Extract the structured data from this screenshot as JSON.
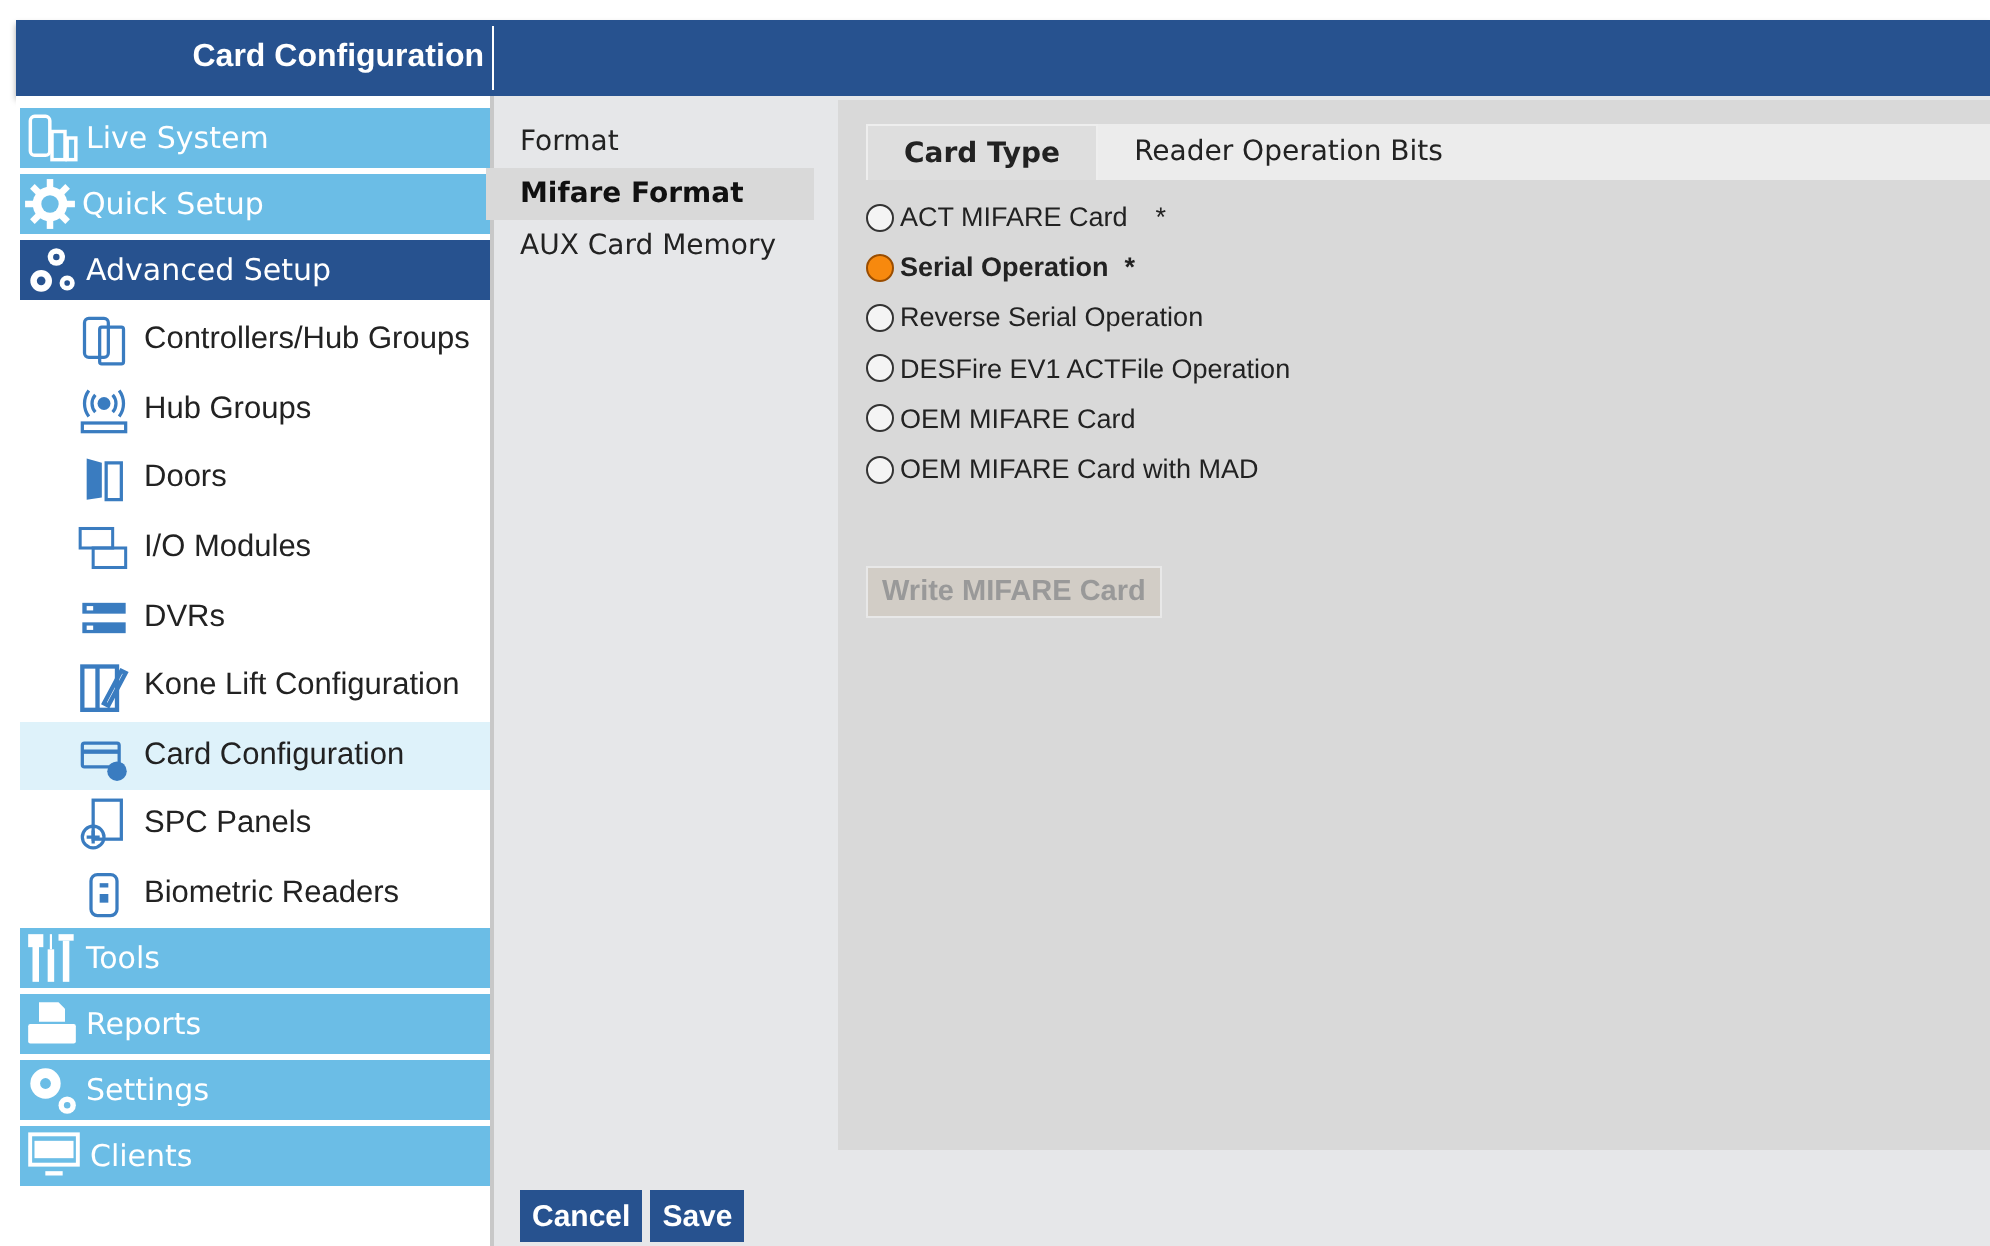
{
  "header": {
    "title": "Card Configuration"
  },
  "sidebar": {
    "items": [
      {
        "label": "Live System",
        "selected": false
      },
      {
        "label": "Quick Setup",
        "selected": false
      },
      {
        "label": "Advanced Setup",
        "selected": true,
        "children": [
          {
            "label": "Controllers/Hub Groups",
            "selected": false
          },
          {
            "label": "Hub Groups",
            "selected": false
          },
          {
            "label": "Doors",
            "selected": false
          },
          {
            "label": "I/O Modules",
            "selected": false
          },
          {
            "label": "DVRs",
            "selected": false
          },
          {
            "label": "Kone Lift Configuration",
            "selected": false
          },
          {
            "label": "Card Configuration",
            "selected": true
          },
          {
            "label": "SPC Panels",
            "selected": false
          },
          {
            "label": "Biometric Readers",
            "selected": false
          }
        ]
      },
      {
        "label": "Tools",
        "selected": false
      },
      {
        "label": "Reports",
        "selected": false
      },
      {
        "label": "Settings",
        "selected": false
      },
      {
        "label": "Clients",
        "selected": false
      }
    ]
  },
  "subnav": [
    {
      "label": "Format",
      "selected": false
    },
    {
      "label": "Mifare Format",
      "selected": true
    },
    {
      "label": "AUX Card Memory",
      "selected": false
    }
  ],
  "tabs": [
    {
      "label": "Card Type",
      "selected": true
    },
    {
      "label": "Reader Operation Bits",
      "selected": false
    }
  ],
  "card_types": [
    {
      "label": "ACT MIFARE Card",
      "note": "*",
      "selected": false
    },
    {
      "label": "Serial Operation",
      "note": "*",
      "selected": true
    },
    {
      "label": "Reverse Serial Operation",
      "selected": false
    },
    {
      "label": "DESFire EV1 ACTFile Operation",
      "selected": false
    },
    {
      "label": "OEM MIFARE Card",
      "selected": false
    },
    {
      "label": "OEM MIFARE Card with MAD",
      "selected": false
    }
  ],
  "write_button": {
    "label": "Write MIFARE Card",
    "disabled": true
  },
  "buttons": [
    "Cancel",
    "Save"
  ]
}
